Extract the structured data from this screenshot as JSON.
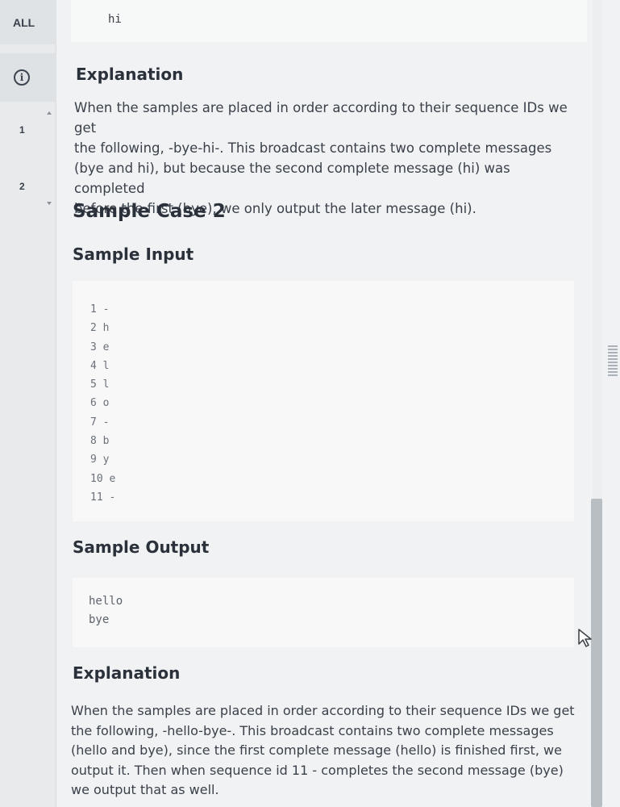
{
  "sidebar": {
    "all_label": "ALL",
    "info_icon": "info-circle-icon",
    "items": [
      {
        "label": "1"
      },
      {
        "label": "2"
      }
    ]
  },
  "top_output": {
    "text": "hi"
  },
  "explanation1": {
    "heading": "Explanation",
    "lines": [
      "When the samples are placed in order according to their sequence IDs we get",
      "the following, -bye-hi-. This broadcast contains two complete messages",
      "(bye and hi), but because the second complete message (hi) was completed",
      "before the first (bye), we only output the later message (hi)."
    ]
  },
  "case2": {
    "title": "Sample Case 2",
    "input_heading": "Sample Input",
    "input_lines": [
      "1 -",
      "2 h",
      "3 e",
      "4 l",
      "5 l",
      "6 o",
      "7 -",
      "8 b",
      "9 y",
      "10 e",
      "11 -"
    ],
    "output_heading": "Sample Output",
    "output_lines": [
      "hello",
      "bye"
    ],
    "explanation_heading": "Explanation",
    "explanation_lines": [
      "When the samples are placed in order according to their sequence IDs we get",
      "the following, -hello-bye-. This broadcast contains two complete messages",
      "(hello and bye), since the first complete message (hello) is finished first, we",
      "output it. Then when sequence id 11 - completes the second message (bye)",
      "we output that as well."
    ]
  },
  "colors": {
    "background": "#f1f2f3",
    "code_box": "#f8f8f9",
    "text": "#2d3440"
  }
}
